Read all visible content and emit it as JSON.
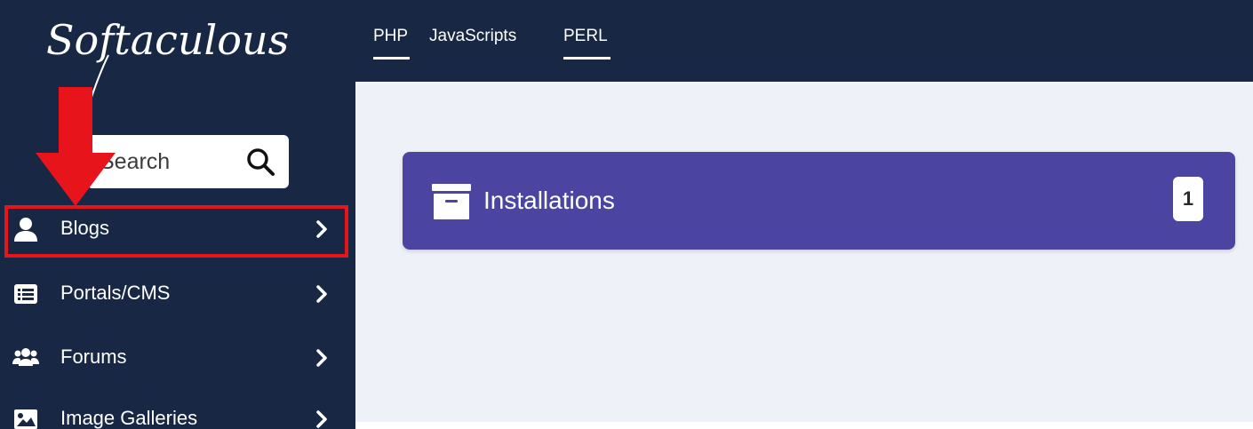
{
  "logo": {
    "text": "Softaculous"
  },
  "search": {
    "placeholder": "Search",
    "value": ""
  },
  "tabs": [
    {
      "label": "PHP",
      "active": true
    },
    {
      "label": "JavaScripts",
      "active": false
    },
    {
      "label": "PERL",
      "active": true
    }
  ],
  "sidebar": {
    "items": [
      {
        "label": "Blogs",
        "icon": "user-icon",
        "highlighted": true
      },
      {
        "label": "Portals/CMS",
        "icon": "list-icon",
        "highlighted": false
      },
      {
        "label": "Forums",
        "icon": "users-icon",
        "highlighted": false
      },
      {
        "label": "Image Galleries",
        "icon": "image-icon",
        "highlighted": false
      }
    ]
  },
  "card": {
    "title": "Installations",
    "count": "1",
    "icon": "archive-icon"
  },
  "colors": {
    "navy": "#182743",
    "accent": "#4b45a1",
    "highlight": "#e8141c",
    "content_bg": "#eef2f8"
  }
}
